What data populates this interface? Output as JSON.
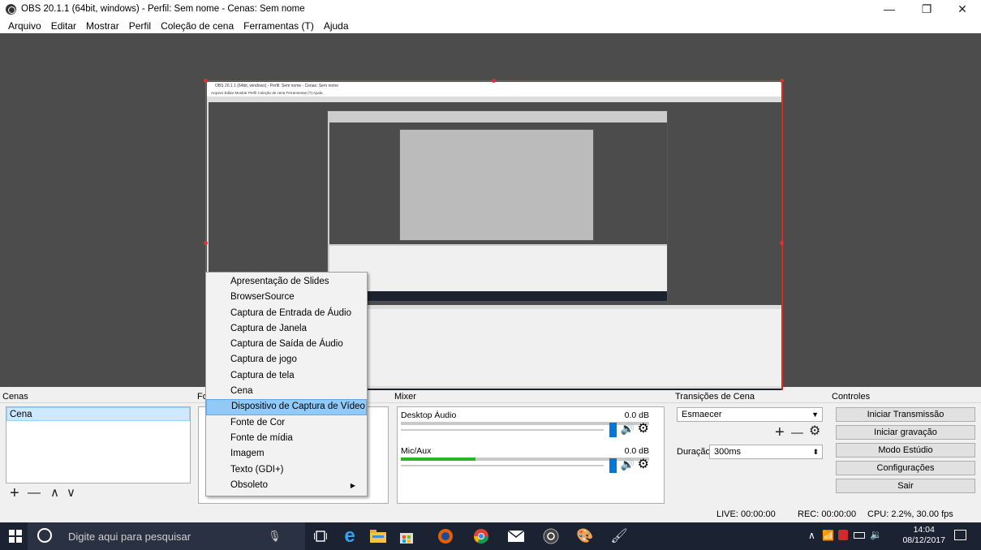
{
  "window": {
    "title": "OBS 20.1.1 (64bit, windows) - Perfil: Sem nome - Cenas: Sem nome",
    "minimize_glyph": "—",
    "maximize_glyph": "❐",
    "close_glyph": "✕"
  },
  "menubar": {
    "items": [
      "Arquivo",
      "Editar",
      "Mostrar",
      "Perfil",
      "Coleção de cena",
      "Ferramentas (T)",
      "Ajuda"
    ]
  },
  "nested_preview": {
    "title": "OBS 20.1.1 (64bit, windows) - Perfil: Sem nome - Cenas: Sem nome",
    "menu": "Arquivo   Editar   Mostrar   Perfil   Coleção de cena   Ferramentas (T)   Ajuda"
  },
  "docks": {
    "scenes": {
      "header": "Cenas",
      "items": [
        "Cena"
      ],
      "add_glyph": "+",
      "remove_glyph": "—",
      "up_glyph": "∧",
      "down_glyph": "∨"
    },
    "sources": {
      "header": "Fo"
    },
    "mixer": {
      "header": "Mixer",
      "channels": [
        {
          "name": "Desktop Áudio",
          "db": "0.0 dB",
          "level": 0.0
        },
        {
          "name": "Mic/Aux",
          "db": "0.0 dB",
          "level": 0.3
        }
      ]
    },
    "transitions": {
      "header": "Transições de Cena",
      "selected": "Esmaecer",
      "duration_label": "Duração",
      "duration_value": "300ms",
      "add_glyph": "+",
      "remove_glyph": "—"
    },
    "controls": {
      "header": "Controles",
      "buttons": [
        "Iniciar Transmissão",
        "Iniciar gravação",
        "Modo Estúdio",
        "Configurações",
        "Sair"
      ]
    }
  },
  "status": {
    "live": "LIVE: 00:00:00",
    "rec": "REC: 00:00:00",
    "cpu": "CPU: 2.2%, 30.00 fps"
  },
  "context_menu": {
    "items": [
      "Apresentação de Slides",
      "BrowserSource",
      "Captura de Entrada de Áudio",
      "Captura de Janela",
      "Captura de Saída de Áudio",
      "Captura de jogo",
      "Captura de tela",
      "Cena",
      "Dispositivo de Captura de Vídeo",
      "Fonte de Cor",
      "Fonte de mídia",
      "Imagem",
      "Texto (GDI+)",
      "Obsoleto"
    ],
    "highlighted_index": 8
  },
  "taskbar": {
    "search_placeholder": "Digite aqui para pesquisar",
    "time": "14:04",
    "date": "08/12/2017"
  },
  "colors": {
    "selection_red": "#e03030",
    "accent_blue": "#0078d7",
    "meter_green": "#28b428",
    "menu_highlight": "#91c9f7"
  }
}
